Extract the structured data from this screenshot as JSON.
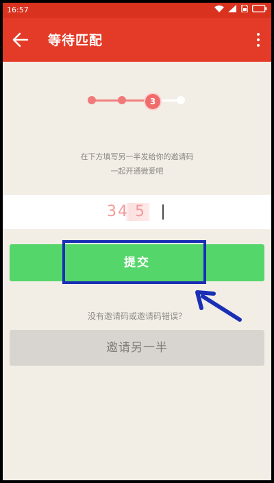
{
  "status_bar": {
    "time": "16:57",
    "icons": [
      "wifi-icon",
      "signal-icon",
      "sim-icon",
      "battery-icon"
    ]
  },
  "app_bar": {
    "title": "等待匹配",
    "back_icon": "back-arrow-icon",
    "menu_icon": "more-vert-icon",
    "color": "#e43b28"
  },
  "stepper": {
    "current_step": "3",
    "total_steps": 4
  },
  "instructions": {
    "line1": "在下方填写另一半发给你的邀请码",
    "line2": "一起开通微爱吧"
  },
  "code_input": {
    "value": "34  5"
  },
  "submit_button": {
    "label": "提交",
    "color": "#54d66a"
  },
  "hint_link": "没有邀请码或邀请码错误？",
  "invite_button": {
    "label": "邀请另一半"
  },
  "annotation": {
    "highlight_color": "#1a2fb5"
  }
}
